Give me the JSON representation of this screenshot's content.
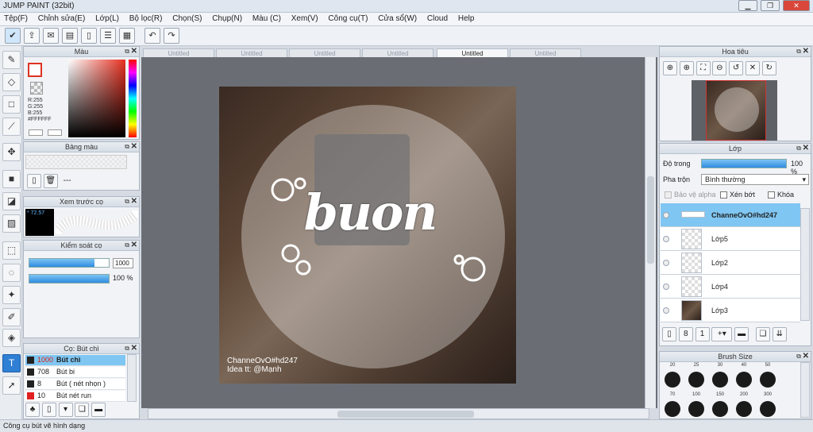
{
  "app": {
    "title": "JUMP PAINT (32bit)"
  },
  "window_controls": {
    "minimize": "▁",
    "restore": "❐",
    "close": "✕"
  },
  "menu": [
    "Tệp(F)",
    "Chỉnh sửa(E)",
    "Lớp(L)",
    "Bộ lọc(R)",
    "Chọn(S)",
    "Chụp(N)",
    "Màu (C)",
    "Xem(V)",
    "Công cụ(T)",
    "Cửa sổ(W)",
    "Cloud",
    "Help"
  ],
  "doc_tabs": [
    "Untitled",
    "Untitled",
    "Untitled",
    "Untitled",
    "Untitled",
    "Untitled"
  ],
  "color_panel": {
    "title": "Màu",
    "r": "R:255",
    "g": "G:255",
    "b": "B:255",
    "hex": "#FFFFFF"
  },
  "palette_panel": {
    "title": "Bảng màu",
    "value": "---"
  },
  "brush_preview": {
    "title": "Xem trước cọ",
    "size": "* 72.57"
  },
  "brush_control": {
    "title": "Kiểm soát cọ",
    "size_value": "1000",
    "opacity_value": "100 %",
    "size_fill": 0.82,
    "opacity_fill": 1.0
  },
  "brush_list": {
    "title": "Cọ: Bút chì",
    "items": [
      {
        "num": "1000",
        "name": "Bút chì",
        "color": "#222222",
        "selected": true
      },
      {
        "num": "708",
        "name": "Bút bi",
        "color": "#222222",
        "selected": false
      },
      {
        "num": "8",
        "name": "Bút ( nét nhọn )",
        "color": "#222222",
        "selected": false
      },
      {
        "num": "10",
        "name": "Bút nét run",
        "color": "#e02020",
        "selected": false
      }
    ]
  },
  "canvas": {
    "title_word": "buon",
    "caption_line1": "ChanneOvO#hd247",
    "caption_line2": "Idea tt: @Mạnh"
  },
  "navigator": {
    "title": "Hoa tiêu"
  },
  "layers_panel": {
    "title": "Lớp",
    "opacity_label": "Độ trong",
    "opacity_value": "100 %",
    "opacity_fill": 1.0,
    "blend_label": "Pha trộn",
    "blend_value": "Bình thường",
    "protect_alpha": "Bảo vệ alpha",
    "clip": "Xén bớt",
    "lock": "Khóa",
    "layers": [
      {
        "name": "ChanneOvO#hd247",
        "selected": true
      },
      {
        "name": "Lớp5",
        "selected": false
      },
      {
        "name": "Lớp2",
        "selected": false
      },
      {
        "name": "Lớp4",
        "selected": false
      },
      {
        "name": "Lớp3",
        "selected": false
      }
    ]
  },
  "brush_size": {
    "title": "Brush Size",
    "row1": [
      "20",
      "25",
      "30",
      "40",
      "50"
    ],
    "row2": [
      "70",
      "100",
      "150",
      "200",
      "300"
    ]
  },
  "status": {
    "text": "Công cụ bút vẽ hình dạng"
  }
}
